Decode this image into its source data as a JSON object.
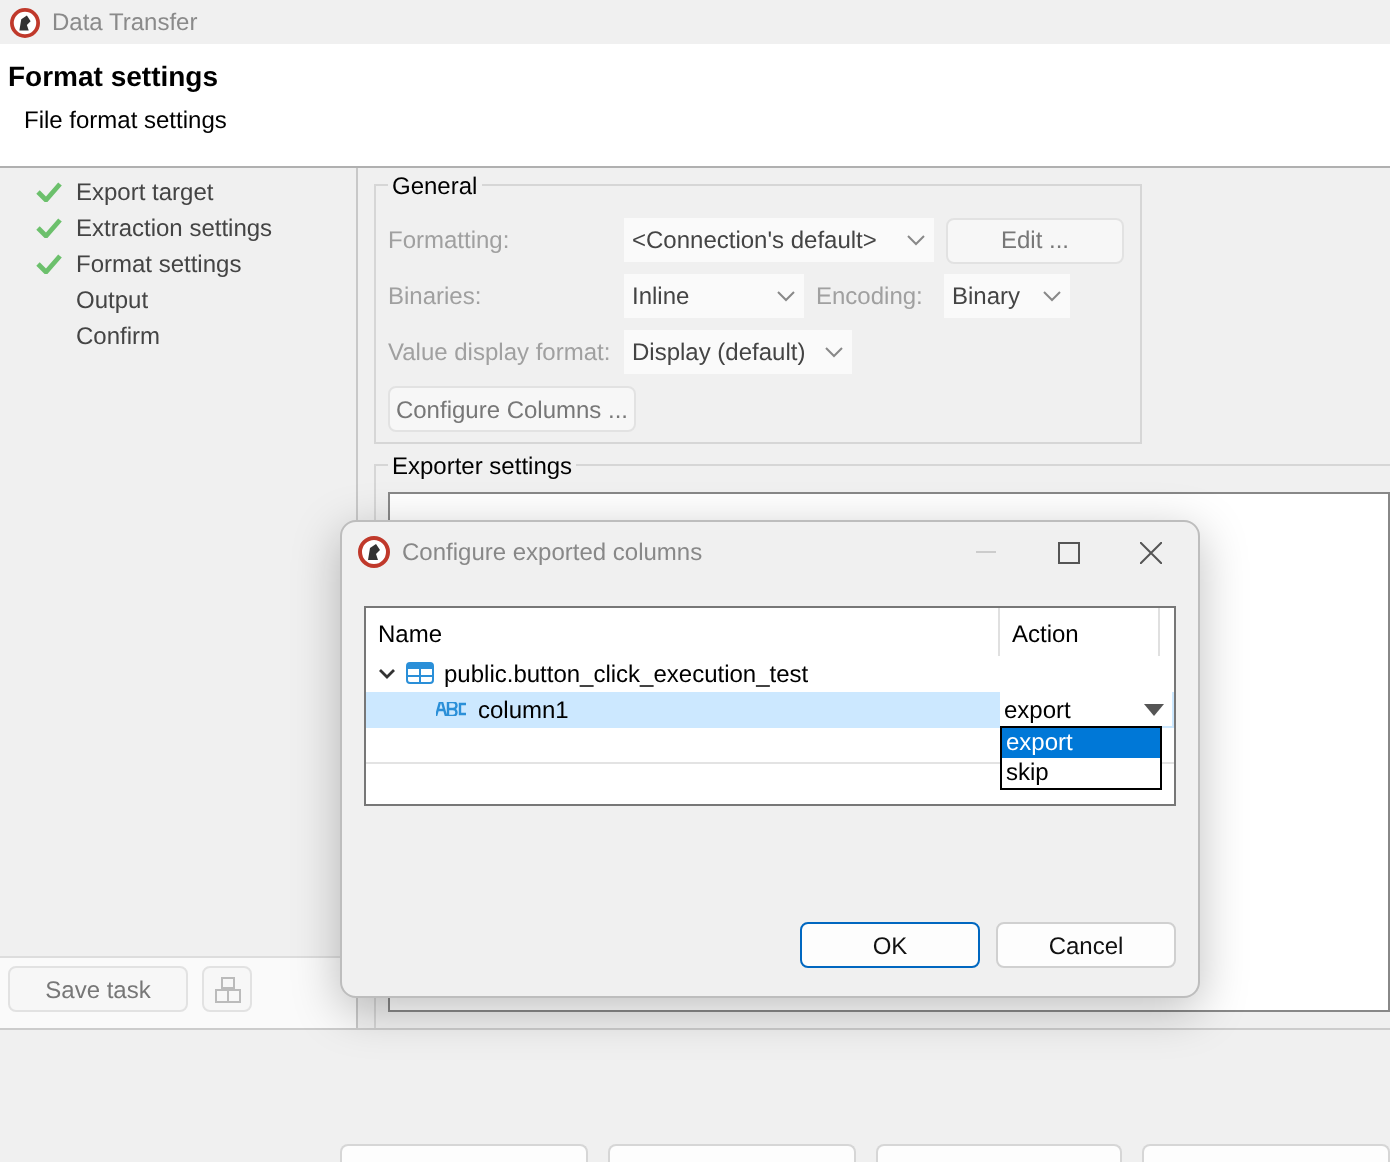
{
  "window": {
    "title": "Data Transfer"
  },
  "header": {
    "title": "Format settings",
    "subtitle": "File format settings"
  },
  "steps": [
    {
      "label": "Export target",
      "completed": true
    },
    {
      "label": "Extraction settings",
      "completed": true
    },
    {
      "label": "Format settings",
      "completed": true
    },
    {
      "label": "Output",
      "completed": false
    },
    {
      "label": "Confirm",
      "completed": false
    }
  ],
  "general": {
    "title": "General",
    "formatting": {
      "label": "Formatting:",
      "value": "<Connection's default>"
    },
    "edit_button": "Edit ...",
    "binaries": {
      "label": "Binaries:",
      "value": "Inline"
    },
    "encoding": {
      "label": "Encoding:",
      "value": "Binary"
    },
    "value_display_format": {
      "label": "Value display format:",
      "value": "Display (default)"
    },
    "configure_button": "Configure Columns ..."
  },
  "exporter_settings": {
    "title": "Exporter settings"
  },
  "save_task_button": "Save task",
  "dialog": {
    "title": "Configure exported columns",
    "columns": [
      "Name",
      "Action"
    ],
    "tree": [
      {
        "name": "public.button_click_execution_test",
        "kind": "table",
        "expanded": true,
        "selected": false,
        "children": [
          {
            "name": "column1",
            "kind": "column",
            "selected": true,
            "action": "export"
          }
        ]
      }
    ],
    "dropdown_options": [
      {
        "label": "export",
        "selected": true
      },
      {
        "label": "skip",
        "selected": false
      }
    ],
    "buttons": [
      {
        "label": "OK",
        "default": true
      },
      {
        "label": "Cancel",
        "default": false
      }
    ]
  }
}
